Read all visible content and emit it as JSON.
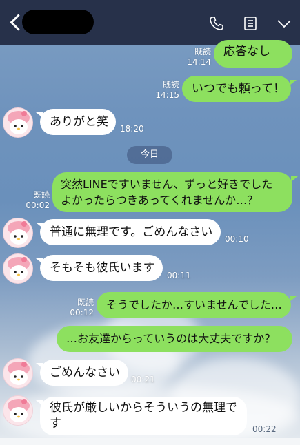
{
  "header": {
    "back_icon": "chevron-left-icon",
    "phone_icon": "phone-icon",
    "memo_icon": "memo-icon",
    "menu_icon": "chevron-down-icon"
  },
  "colors": {
    "header_bg": "#27314a",
    "sent_bubble": "#8de05f",
    "received_bubble": "#ffffff"
  },
  "date_separator": "今日",
  "messages": [
    {
      "side": "sent",
      "text": "応答なし",
      "read": "既読",
      "time": "14:14"
    },
    {
      "side": "sent",
      "text": "いつでも頼って！",
      "read": "既読",
      "time": "14:15"
    },
    {
      "side": "received",
      "text": "ありがと笑",
      "time": "18:20"
    },
    {
      "side": "sent",
      "line1": "突然LINEですいません、ずっと好きでした",
      "line2": "よかったらつきあってくれませんか…？",
      "read": "既読",
      "time": "00:02"
    },
    {
      "side": "received",
      "text": "普通に無理です。ごめんなさい",
      "time": "00:10"
    },
    {
      "side": "received",
      "text": "そもそも彼氏います",
      "time": "00:11"
    },
    {
      "side": "sent",
      "text": "そうでしたか…すいませんでした…",
      "read": "既読",
      "time": "00:12"
    },
    {
      "side": "sent",
      "text": "…お友達からっていうのは大丈夫ですか？",
      "time": ""
    },
    {
      "side": "received",
      "text": "ごめんなさい",
      "time": "00:21"
    },
    {
      "side": "received",
      "line1": "彼氏が厳しいからそういうの無理で",
      "line2": "す",
      "time": "00:22"
    }
  ]
}
